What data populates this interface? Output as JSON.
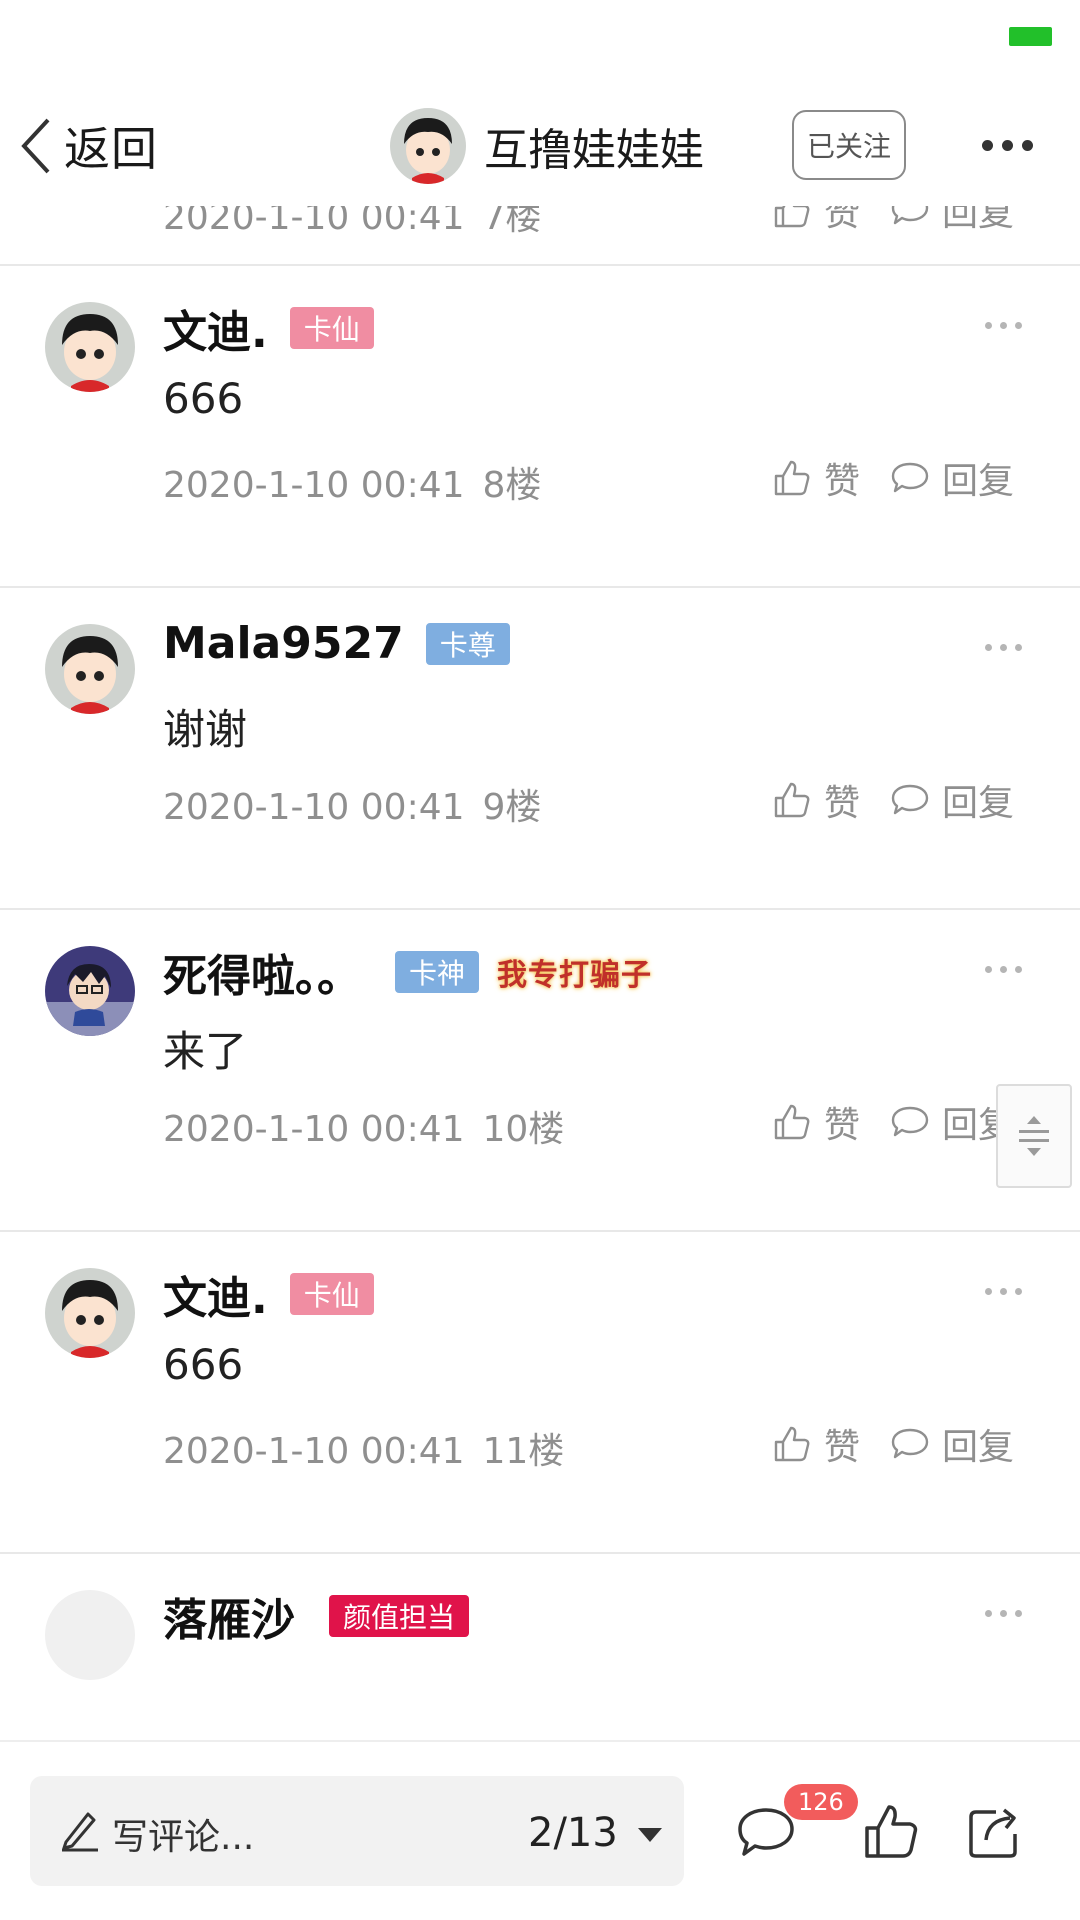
{
  "header": {
    "back_label": "返回",
    "title": "互撸娃娃娃",
    "follow_label": "已关注"
  },
  "actions": {
    "like_label": "赞",
    "reply_label": "回复"
  },
  "top_meta": {
    "time": "2020-1-10 00:41",
    "floor": "7楼"
  },
  "comments": [
    {
      "name": "文迪.",
      "badge": "卡仙",
      "badge_color": "#f08da2",
      "text": "666",
      "time": "2020-1-10 00:41",
      "floor": "8楼"
    },
    {
      "name": "Mala9527",
      "badge": "卡尊",
      "badge_color": "#7faee0",
      "text": "谢谢",
      "time": "2020-1-10 00:41",
      "floor": "9楼"
    },
    {
      "name": "死得啦。。",
      "badge": "卡神",
      "badge_color": "#7faee0",
      "medal": "我专打骗子",
      "text": "来了",
      "time": "2020-1-10 00:41",
      "floor": "10楼"
    },
    {
      "name": "文迪.",
      "badge": "卡仙",
      "badge_color": "#f08da2",
      "text": "666",
      "time": "2020-1-10 00:41",
      "floor": "11楼"
    },
    {
      "name": "落雁沙",
      "badge": "颜值担当",
      "badge_color": "#e0134a"
    }
  ],
  "bottom": {
    "placeholder": "写评论...",
    "page_indicator": "2/13",
    "comment_count": "126"
  },
  "colors": {
    "battery": "#22c02a",
    "badge_red": "#f25c5c"
  }
}
